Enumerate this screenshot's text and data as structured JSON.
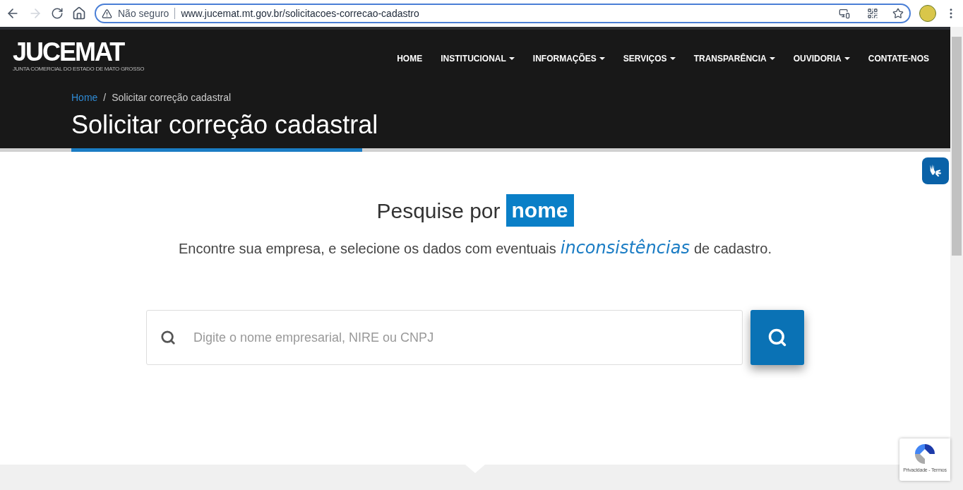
{
  "browser": {
    "security_label": "Não seguro",
    "url": "www.jucemat.mt.gov.br/solicitacoes-correcao-cadastro"
  },
  "header": {
    "logo": "JUCEMAT",
    "logo_subtitle": "JUNTA COMERCIAL DO ESTADO DE MATO GROSSO",
    "nav": [
      {
        "label": "HOME",
        "dropdown": false
      },
      {
        "label": "INSTITUCIONAL",
        "dropdown": true
      },
      {
        "label": "INFORMAÇÕES",
        "dropdown": true
      },
      {
        "label": "SERVIÇOS",
        "dropdown": true
      },
      {
        "label": "TRANSPARÊNCIA",
        "dropdown": true
      },
      {
        "label": "OUVIDORIA",
        "dropdown": true
      },
      {
        "label": "CONTATE-NOS",
        "dropdown": false
      }
    ],
    "breadcrumb": [
      {
        "label": "Home",
        "link": true
      },
      {
        "label": "Solicitar correção cadastral",
        "link": false
      }
    ],
    "separator": "/",
    "title": "Solicitar correção cadastral"
  },
  "search_section": {
    "heading": "Pesquise por",
    "heading_highlight": "nome",
    "intro": "Encontre sua empresa, e selecione os dados com eventuais",
    "intro_highlight": "inconsistências",
    "intro_end": "de cadastro.",
    "placeholder": "Digite o nome empresarial, NIRE ou CNPJ"
  },
  "recaptcha": {
    "footer": "Privacidade - Termos"
  }
}
